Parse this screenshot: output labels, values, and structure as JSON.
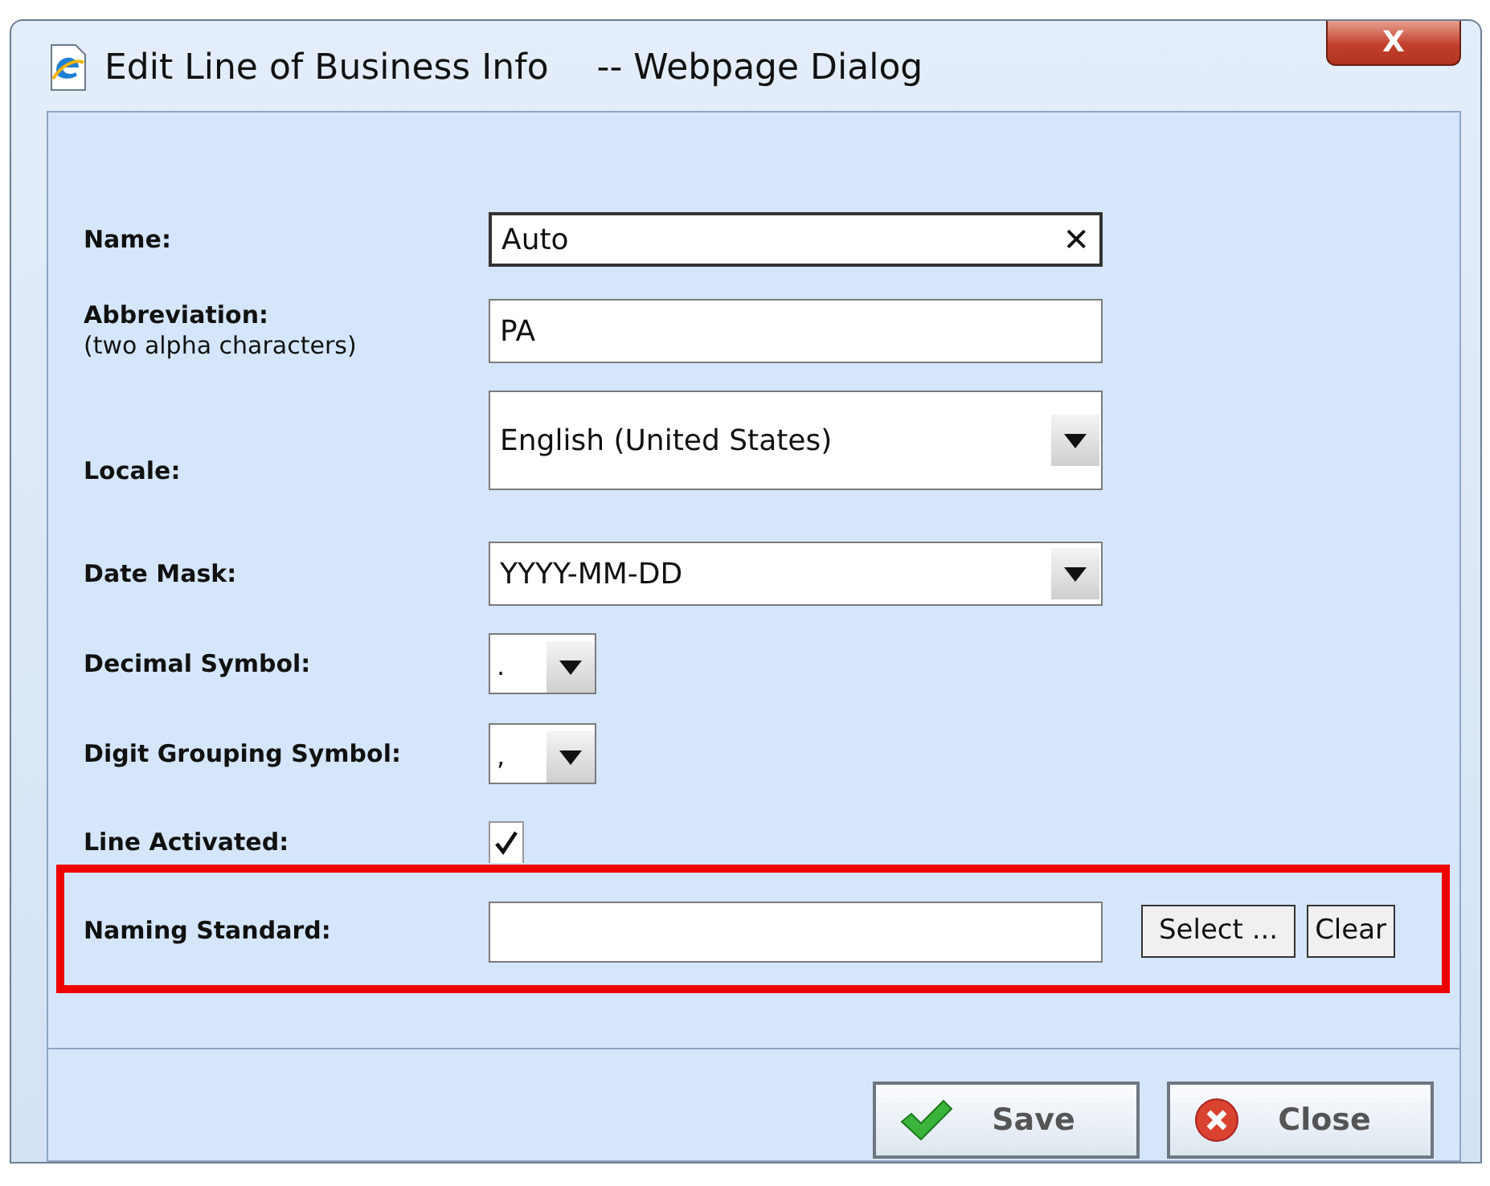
{
  "window": {
    "title": "Edit Line of Business Info",
    "subtitle": "-- Webpage Dialog",
    "close_label": "X"
  },
  "fields": [
    {
      "kind": "text",
      "label": "Name:",
      "value": "Auto",
      "clear": "✕"
    },
    {
      "kind": "text",
      "label": "Abbreviation:",
      "note": "(two alpha characters)",
      "value": "PA"
    },
    {
      "kind": "select",
      "label": "Locale:",
      "value": "English (United States)"
    },
    {
      "kind": "select",
      "label": "Date Mask:",
      "value": "YYYY-MM-DD"
    },
    {
      "kind": "small-select",
      "label": "Decimal Symbol:",
      "value": "."
    },
    {
      "kind": "small-select",
      "label": "Digit Grouping Symbol:",
      "value": ","
    },
    {
      "kind": "checkbox",
      "label": "Line Activated:",
      "checked": true
    },
    {
      "kind": "picker",
      "label": "Naming Standard:",
      "highlighted": true,
      "buttons": [
        "Select ...",
        "Clear"
      ]
    }
  ],
  "buttons": [
    {
      "kind": "save",
      "label": "Save"
    },
    {
      "kind": "close",
      "label": "Close"
    }
  ]
}
